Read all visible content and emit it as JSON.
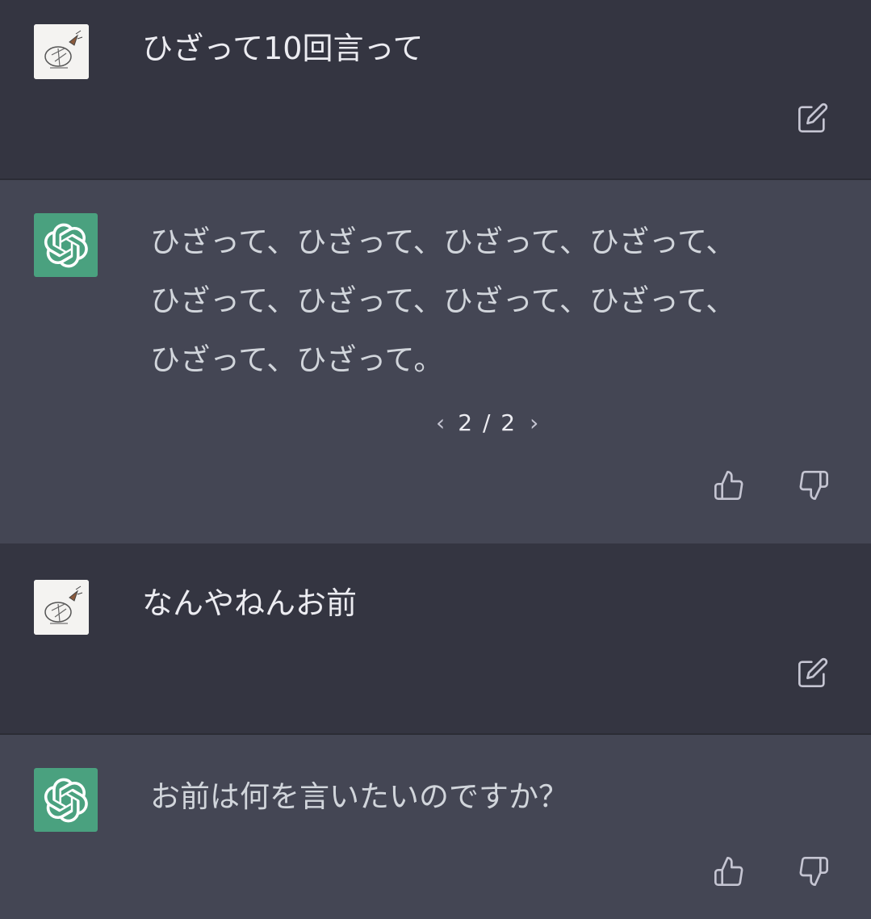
{
  "conversation": {
    "messages": [
      {
        "role": "user",
        "text": "ひざって10回言って",
        "edit_icon": "edit-icon"
      },
      {
        "role": "assistant",
        "lines": [
          "ひざって、ひざって、ひざって、ひざって、",
          "ひざって、ひざって、ひざって、ひざって、",
          "ひざって、ひざって。"
        ],
        "pager": {
          "prev": "‹",
          "current": "2",
          "separator": "/",
          "total": "2",
          "next": "›"
        },
        "feedback": {
          "up_icon": "thumbs-up-icon",
          "down_icon": "thumbs-down-icon"
        }
      },
      {
        "role": "user",
        "text": "なんやねんお前",
        "edit_icon": "edit-icon"
      },
      {
        "role": "assistant",
        "lines": [
          "お前は何を言いたいのですか？"
        ],
        "feedback": {
          "up_icon": "thumbs-up-icon",
          "down_icon": "thumbs-down-icon"
        }
      }
    ]
  },
  "colors": {
    "user_bg": "#343541",
    "assistant_bg": "#444654",
    "gpt_avatar": "#4aa17f",
    "text": "#ececf1"
  }
}
